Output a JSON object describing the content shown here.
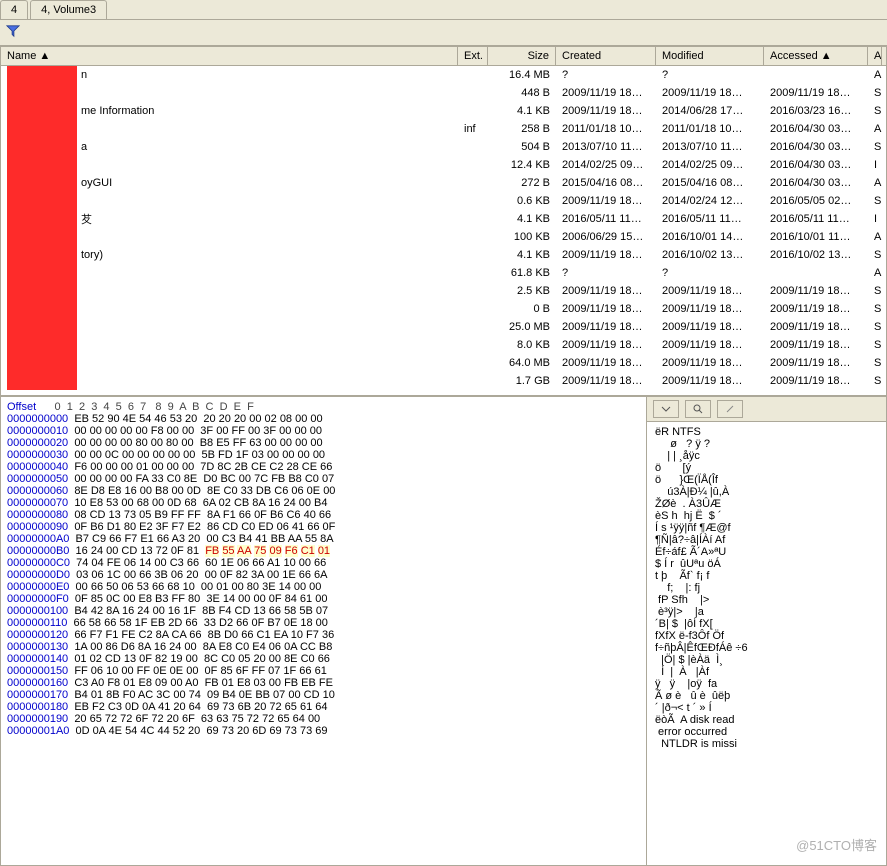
{
  "tabs": {
    "t1": "4",
    "t2": "4, Volume3"
  },
  "headers": {
    "name": "Name ▲",
    "ext": "Ext.",
    "size": "Size",
    "created": "Created",
    "modified": "Modified",
    "accessed": "Accessed ▲",
    "attr": "A"
  },
  "rows": [
    {
      "name": "n",
      "ext": "",
      "size": "16.4 MB",
      "created": "?",
      "modified": "?",
      "accessed": "",
      "attr": "A"
    },
    {
      "name": "",
      "ext": "",
      "size": "448 B",
      "created": "2009/11/19  18…",
      "modified": "2009/11/19  18…",
      "accessed": "2009/11/19  18…",
      "attr": "S"
    },
    {
      "name": "me Information",
      "ext": "",
      "size": "4.1 KB",
      "created": "2009/11/19  18…",
      "modified": "2014/06/28  17…",
      "accessed": "2016/03/23  16…",
      "attr": "S"
    },
    {
      "name": "",
      "ext": "inf",
      "size": "258 B",
      "created": "2011/01/18  10…",
      "modified": "2011/01/18  10…",
      "accessed": "2016/04/30  03…",
      "attr": "A"
    },
    {
      "name": "a",
      "ext": "",
      "size": "504 B",
      "created": "2013/07/10  11…",
      "modified": "2013/07/10  11…",
      "accessed": "2016/04/30  03…",
      "attr": "S"
    },
    {
      "name": "",
      "ext": "",
      "size": "12.4 KB",
      "created": "2014/02/25  09…",
      "modified": "2014/02/25  09…",
      "accessed": "2016/04/30  03…",
      "attr": "I"
    },
    {
      "name": "oyGUI",
      "ext": "",
      "size": "272 B",
      "created": "2015/04/16  08…",
      "modified": "2015/04/16  08…",
      "accessed": "2016/04/30  03…",
      "attr": "A"
    },
    {
      "name": "",
      "ext": "",
      "size": "0.6 KB",
      "created": "2009/11/19  18…",
      "modified": "2014/02/24  12…",
      "accessed": "2016/05/05  02…",
      "attr": "S"
    },
    {
      "name": "䒘",
      "ext": "",
      "size": "4.1 KB",
      "created": "2016/05/11  11…",
      "modified": "2016/05/11  11…",
      "accessed": "2016/05/11  11…",
      "attr": "I"
    },
    {
      "name": "",
      "ext": "",
      "size": "100 KB",
      "created": "2006/06/29  15…",
      "modified": "2016/10/01  14…",
      "accessed": "2016/10/01  11…",
      "attr": "A"
    },
    {
      "name": "tory)",
      "ext": "",
      "size": "4.1 KB",
      "created": "2009/11/19  18…",
      "modified": "2016/10/02  13…",
      "accessed": "2016/10/02  13…",
      "attr": "S"
    },
    {
      "name": "",
      "ext": "",
      "size": "61.8 KB",
      "created": "?",
      "modified": "?",
      "accessed": "",
      "attr": "A"
    },
    {
      "name": "",
      "ext": "",
      "size": "2.5 KB",
      "created": "2009/11/19  18…",
      "modified": "2009/11/19  18…",
      "accessed": "2009/11/19  18…",
      "attr": "S"
    },
    {
      "name": "",
      "ext": "",
      "size": "0 B",
      "created": "2009/11/19  18…",
      "modified": "2009/11/19  18…",
      "accessed": "2009/11/19  18…",
      "attr": "S"
    },
    {
      "name": "",
      "ext": "",
      "size": "25.0 MB",
      "created": "2009/11/19  18…",
      "modified": "2009/11/19  18…",
      "accessed": "2009/11/19  18…",
      "attr": "S"
    },
    {
      "name": "",
      "ext": "",
      "size": "8.0 KB",
      "created": "2009/11/19  18…",
      "modified": "2009/11/19  18…",
      "accessed": "2009/11/19  18…",
      "attr": "S"
    },
    {
      "name": "",
      "ext": "",
      "size": "64.0 MB",
      "created": "2009/11/19  18…",
      "modified": "2009/11/19  18…",
      "accessed": "2009/11/19  18…",
      "attr": "S"
    },
    {
      "name": "",
      "ext": "",
      "size": "1.7 GB",
      "created": "2009/11/19  18…",
      "modified": "2009/11/19  18…",
      "accessed": "2009/11/19  18…",
      "attr": "S"
    }
  ],
  "hex": {
    "header_label": "Offset",
    "cols": "0  1  2  3  4  5  6  7   8  9  A  B  C  D  E  F",
    "rows": [
      {
        "off": "0000000000",
        "b": "EB 52 90 4E 54 46 53 20  20 20 20 00 02 08 00 00",
        "a": "ëR NTFS"
      },
      {
        "off": "0000000010",
        "b": "00 00 00 00 00 F8 00 00  3F 00 FF 00 3F 00 00 00",
        "a": "     ø   ? ÿ ?"
      },
      {
        "off": "0000000020",
        "b": "00 00 00 00 80 00 80 00  B8 E5 FF 63 00 00 00 00",
        "a": "    | | ¸åÿc"
      },
      {
        "off": "0000000030",
        "b": "00 00 0C 00 00 00 00 00  5B FD 1F 03 00 00 00 00",
        "a": "ö       [ý"
      },
      {
        "off": "0000000040",
        "b": "F6 00 00 00 01 00 00 00  7D 8C 2B CE C2 28 CE 66",
        "a": "ö      }Œ(ÏÅ(Îf"
      },
      {
        "off": "0000000050",
        "b": "00 00 00 00 FA 33 C0 8E  D0 BC 00 7C FB B8 C0 07",
        "a": "    ú3À|Ð¼ |û,À"
      },
      {
        "off": "0000000060",
        "b": "8E D8 E8 16 00 B8 00 0D  8E C0 33 DB C6 06 0E 00",
        "a": "ŽØè  . À3ÛÆ"
      },
      {
        "off": "0000000070",
        "b": "10 E8 53 00 68 00 0D 68  6A 02 CB 8A 16 24 00 B4",
        "a": "èS h  hj Ë  $ ´"
      },
      {
        "off": "0000000080",
        "b": "08 CD 13 73 05 B9 FF FF  8A F1 66 0F B6 C6 40 66",
        "a": "Í s ¹ÿÿ|ñf ¶Æ@f"
      },
      {
        "off": "0000000090",
        "b": "0F B6 D1 80 E2 3F F7 E2  86 CD C0 ED 06 41 66 0F",
        "a": "¶Ñ|â?÷â|ÍÀí Af"
      },
      {
        "off": "00000000A0",
        "b": "B7 C9 66 F7 E1 66 A3 20  00 C3 B4 41 BB AA 55 8A",
        "a": "Éf÷áf£ Ã´A»ªU"
      },
      {
        "off": "00000000B0",
        "b": "16 24 00 CD 13 72 0F 81  FB 55 AA 75 09 F6 C1 01",
        "a": "$ Í r  ûUªu öÁ",
        "hl": [
          8,
          15
        ]
      },
      {
        "off": "00000000C0",
        "b": "74 04 FE 06 14 00 C3 66  60 1E 06 66 A1 10 00 66",
        "a": "t þ    Ãf` f¡ f"
      },
      {
        "off": "00000000D0",
        "b": "03 06 1C 00 66 3B 06 20  00 0F 82 3A 00 1E 66 6A",
        "a": "    f;    |: fj"
      },
      {
        "off": "00000000E0",
        "b": "00 66 50 06 53 66 68 10  00 01 00 80 3E 14 00 00",
        "a": " fP Sfh    |>"
      },
      {
        "off": "00000000F0",
        "b": "0F 85 0C 00 E8 B3 FF 80  3E 14 00 00 0F 84 61 00",
        "a": " è³ÿ|>    |a"
      },
      {
        "off": "0000000100",
        "b": "B4 42 8A 16 24 00 16 1F  8B F4 CD 13 66 58 5B 07",
        "a": "´B| $  |ôÍ fX["
      },
      {
        "off": "0000000110",
        "b": "66 58 66 58 1F EB 2D 66  33 D2 66 0F B7 0E 18 00",
        "a": "fXfX ë-f3Ôf Öf"
      },
      {
        "off": "0000000120",
        "b": "66 F7 F1 FE C2 8A CA 66  8B D0 66 C1 EA 10 F7 36",
        "a": "f÷ñþÂ|ÊfŒÐfÁê ÷6"
      },
      {
        "off": "0000000130",
        "b": "1A 00 86 D6 8A 16 24 00  8A E8 C0 E4 06 0A CC B8",
        "a": "  |Ö| $ |èÀä  Ì¸"
      },
      {
        "off": "0000000140",
        "b": "01 02 CD 13 0F 82 19 00  8C C0 05 20 00 8E C0 66",
        "a": "  Í  |  À   |Àf"
      },
      {
        "off": "0000000150",
        "b": "FF 06 10 00 FF 0E 0E 00  0F 85 6F FF 07 1F 66 61",
        "a": "ÿ   ÿ    |oÿ  fa"
      },
      {
        "off": "0000000160",
        "b": "C3 A0 F8 01 E8 09 00 A0  FB 01 E8 03 00 FB EB FE",
        "a": "Ã ø è   û è  ûëþ"
      },
      {
        "off": "0000000170",
        "b": "B4 01 8B F0 AC 3C 00 74  09 B4 0E BB 07 00 CD 10",
        "a": "´ |ð¬< t ´ » Í"
      },
      {
        "off": "0000000180",
        "b": "EB F2 C3 0D 0A 41 20 64  69 73 6B 20 72 65 61 64",
        "a": "ëòÃ  A disk read"
      },
      {
        "off": "0000000190",
        "b": "20 65 72 72 6F 72 20 6F  63 63 75 72 72 65 64 00",
        "a": " error occurred"
      },
      {
        "off": "00000001A0",
        "b": "0D 0A 4E 54 4C 44 52 20  69 73 20 6D 69 73 73 69",
        "a": "  NTLDR is missi"
      }
    ]
  },
  "watermark": "@51CTO博客"
}
